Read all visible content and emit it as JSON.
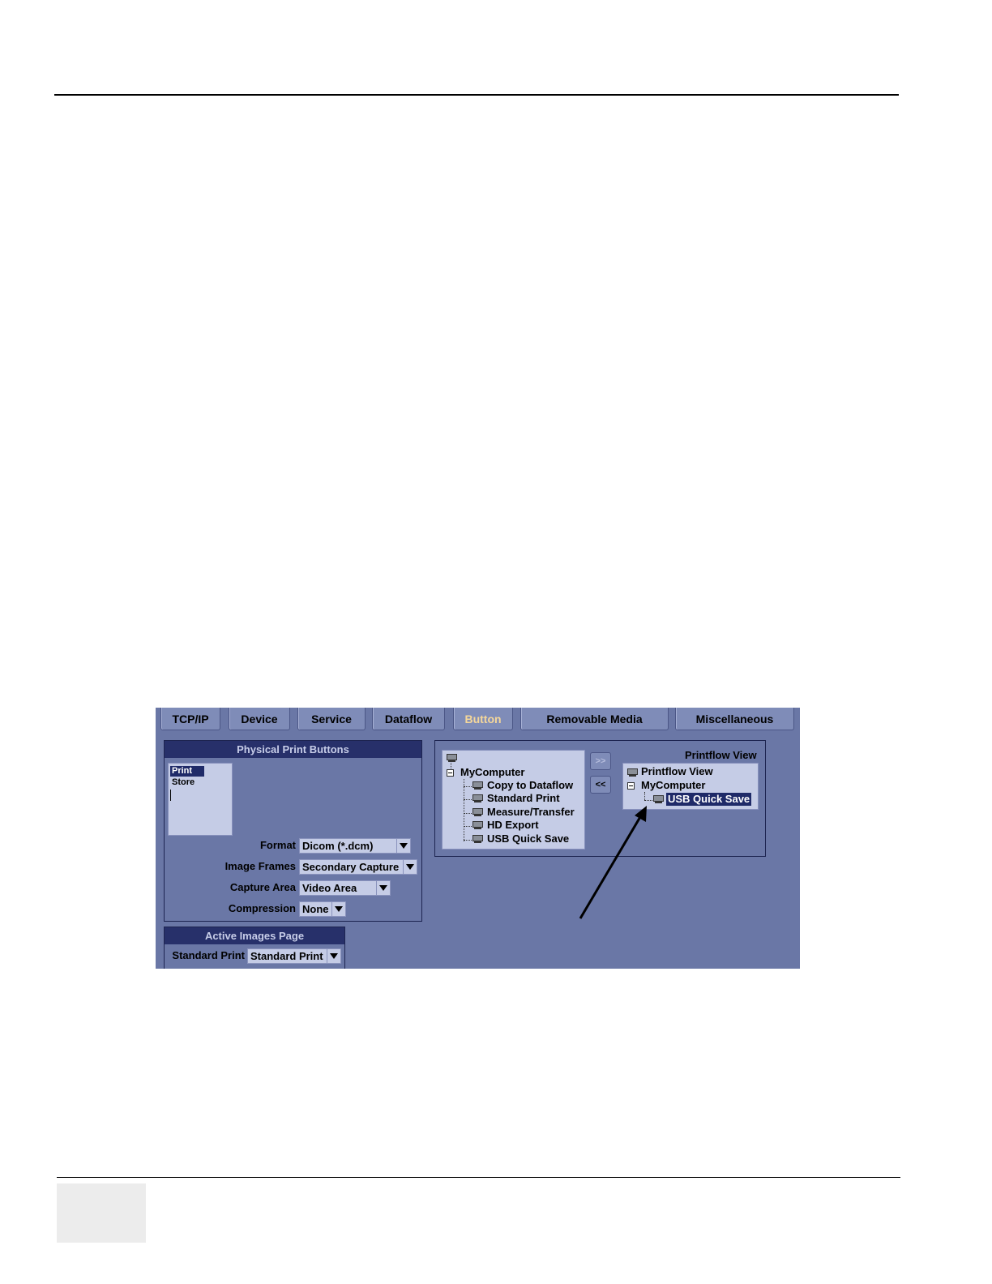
{
  "tabs": [
    {
      "label": "TCP/IP"
    },
    {
      "label": "Device"
    },
    {
      "label": "Service"
    },
    {
      "label": "Dataflow"
    },
    {
      "label": "Button"
    },
    {
      "label": "Removable Media"
    },
    {
      "label": "Miscellaneous"
    }
  ],
  "physical_print": {
    "title": "Physical Print Buttons",
    "buttons": [
      "Print",
      "Store"
    ],
    "format_label": "Format",
    "format_value": "Dicom (*.dcm)",
    "frames_label": "Image Frames",
    "frames_value": "Secondary Capture",
    "capture_label": "Capture Area",
    "capture_value": "Video Area",
    "compression_label": "Compression",
    "compression_value": "None"
  },
  "active_images": {
    "title": "Active Images Page",
    "label": "Standard Print",
    "value": "Standard Print"
  },
  "left_tree": {
    "root": "MyComputer",
    "children": [
      "Copy to Dataflow",
      "Standard Print",
      "Measure/Transfer",
      "HD Export",
      "USB Quick Save"
    ]
  },
  "move_buttons": {
    "add": ">>",
    "remove": "<<"
  },
  "printflow": {
    "title": "Printflow View",
    "root": "Printflow View",
    "computer": "MyComputer",
    "selected": "USB Quick Save"
  }
}
